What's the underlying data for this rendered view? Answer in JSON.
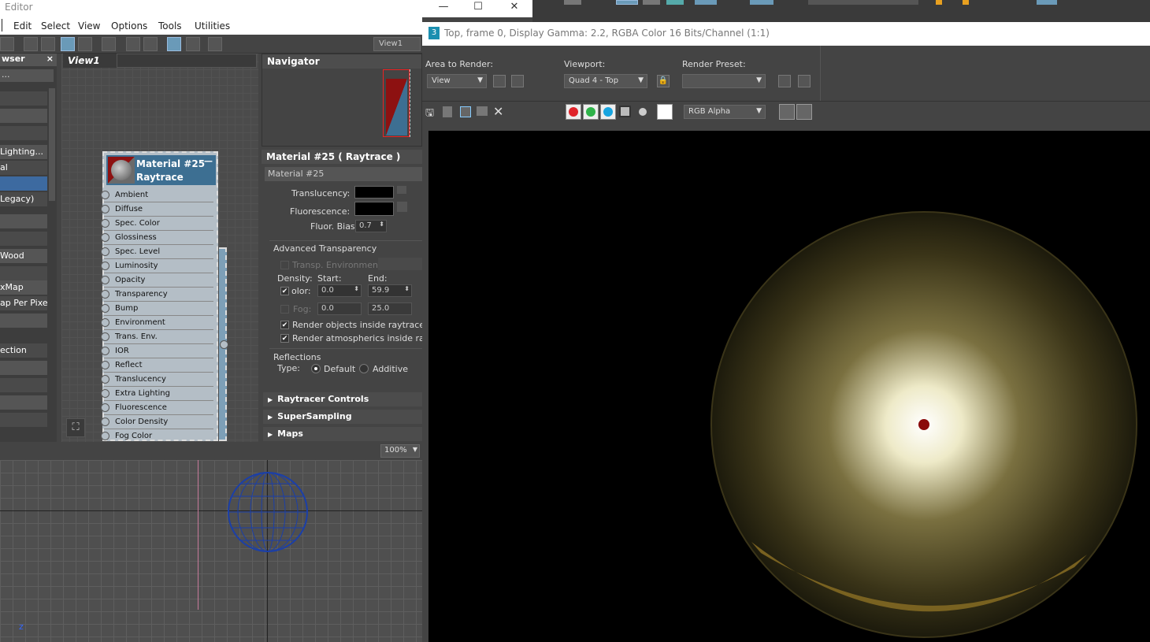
{
  "app": {
    "title": "Editor",
    "menus": [
      "Edit",
      "Select",
      "View",
      "Options",
      "Tools",
      "Utilities"
    ],
    "view_dropdown": "View1"
  },
  "browser": {
    "header": "wser",
    "search_placeholder": "...",
    "items": [
      "",
      "",
      "",
      "Lighting...",
      "al",
      "",
      "Legacy)",
      "",
      "",
      "Wood",
      "",
      "xMap",
      "ap Per Pixel",
      "",
      "ection",
      "",
      "",
      "",
      ""
    ]
  },
  "view1": {
    "tab_label": "View1",
    "node": {
      "title_line1": "Material #25",
      "title_line2": "Raytrace",
      "slots": [
        "Ambient",
        "Diffuse",
        "Spec. Color",
        "Glossiness",
        "Spec. Level",
        "Luminosity",
        "Opacity",
        "Transparency",
        "Bump",
        "Environment",
        "Trans. Env.",
        "IOR",
        "Reflect",
        "Translucency",
        "Extra Lighting",
        "Fluorescence",
        "Color Density",
        "Fog Color"
      ]
    }
  },
  "navigator": {
    "header": "Navigator"
  },
  "params": {
    "header": "Material #25  ( Raytrace )",
    "material_name": "Material #25",
    "translucency_label": "Translucency:",
    "fluorescence_label": "Fluorescence:",
    "fluor_bias_label": "Fluor. Bias:",
    "fluor_bias_value": "0.7",
    "adv_transparency_label": "Advanced Transparency",
    "transp_env_label": "Transp. Environment..",
    "density_label": "Density:",
    "start_label": "Start:",
    "end_label": "End:",
    "color_label": "olor:",
    "color_start": "0.0",
    "color_end": "59.9",
    "fog_label": "Fog:",
    "fog_start": "0.0",
    "fog_end": "25.0",
    "render_objects_label": "Render objects inside raytraced ol",
    "render_atmos_label": "Render atmospherics inside raytra",
    "reflections_label": "Reflections",
    "type_label": "Type:",
    "default_label": "Default",
    "additive_label": "Additive",
    "rollouts": [
      "Raytracer Controls",
      "SuperSampling",
      "Maps"
    ]
  },
  "viewport": {
    "zoom": "100%"
  },
  "render_window": {
    "title": "Top, frame 0, Display Gamma: 2.2, RGBA Color 16 Bits/Channel (1:1)",
    "area_label": "Area to Render:",
    "area_value": "View",
    "viewport_label": "Viewport:",
    "viewport_value": "Quad 4 - Top",
    "preset_label": "Render Preset:",
    "preset_value": "",
    "channel_value": "RGB Alpha",
    "colors": {
      "red": "#e0242b",
      "green": "#2fb34a",
      "blue": "#18a5e0"
    }
  }
}
